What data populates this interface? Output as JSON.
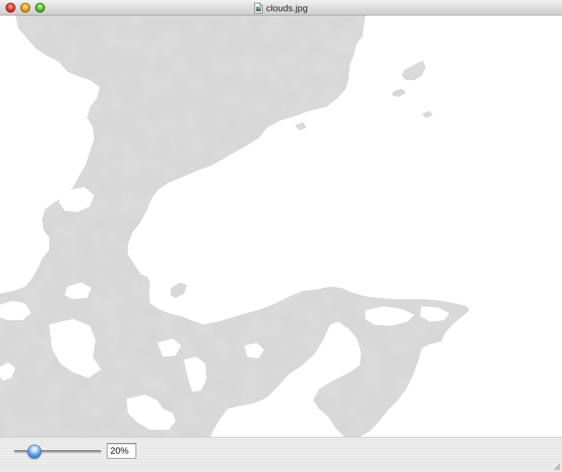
{
  "window": {
    "title": "clouds.jpg",
    "icon": "jpeg-document-icon"
  },
  "controls": {
    "close": "close-button",
    "minimize": "minimize-button",
    "zoom": "zoom-button"
  },
  "image": {
    "description_icon": "cloud-image",
    "cloud_color": "#d6d6d6",
    "background_color": "#ffffff"
  },
  "zoom": {
    "value_label": "20%",
    "slider_fraction": 0.2,
    "accent_color": "#4f96e6"
  }
}
